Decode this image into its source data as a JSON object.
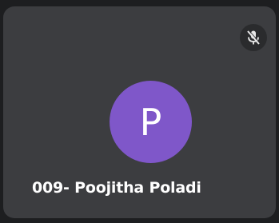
{
  "participant": {
    "avatar_initial": "P",
    "name": "009- Poojitha Poladi",
    "avatar_color": "#7f57c9",
    "mic_status": "muted",
    "mic_icon": "mic-off-icon"
  },
  "colors": {
    "tile_background": "#3c3d40",
    "page_background": "#1d1e20",
    "text": "#ffffff"
  }
}
